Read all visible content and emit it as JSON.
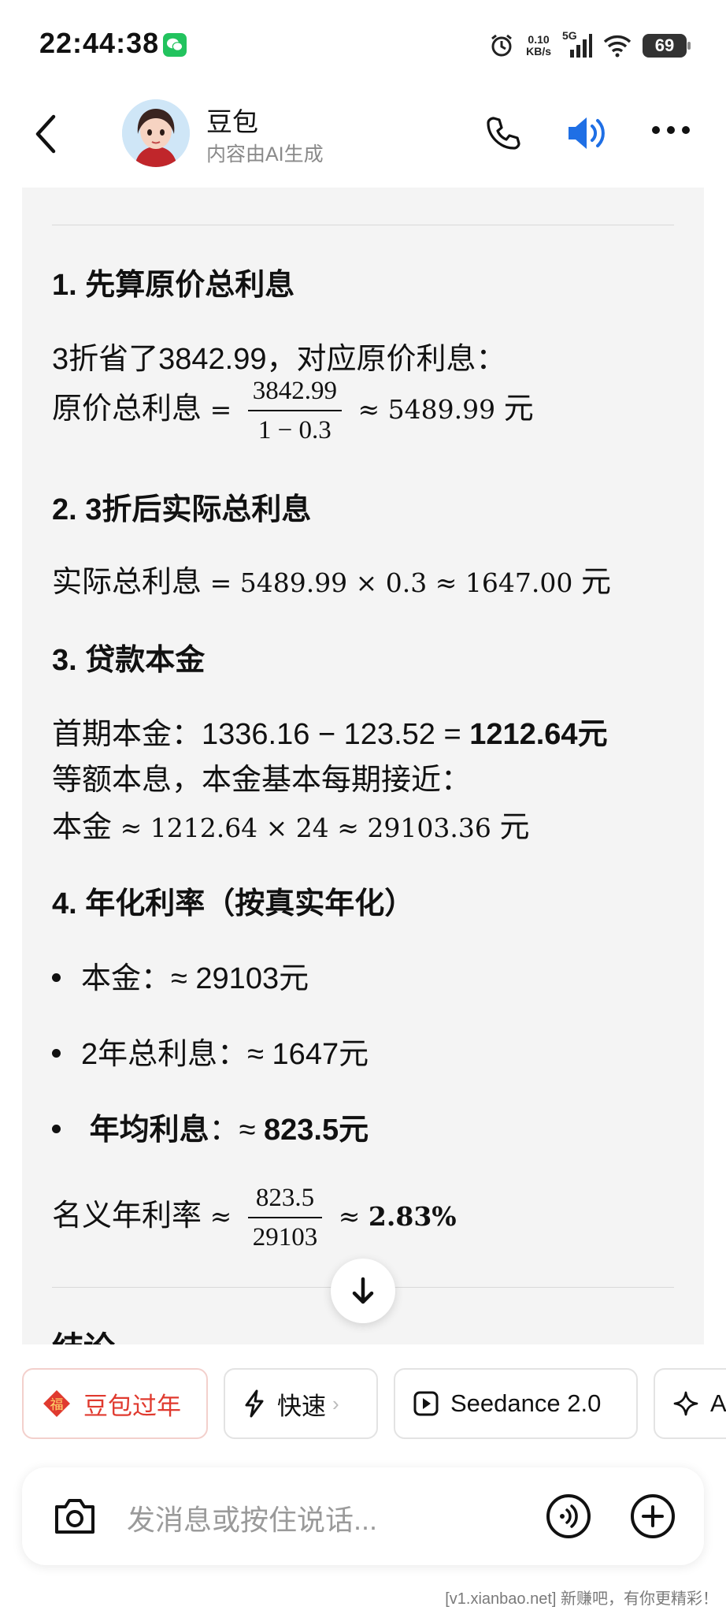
{
  "status_bar": {
    "time": "22:44:38",
    "net_speed_value": "0.10",
    "net_speed_unit": "KB/s",
    "network": "5G",
    "battery": "69"
  },
  "header": {
    "name": "豆包",
    "subtitle": "内容由AI生成"
  },
  "content": {
    "s1_title": "1. 先算原价总利息",
    "s1_line1": "3折省了3842.99，对应原价利息：",
    "s1_eq_label": "原价总利息",
    "s1_frac_num": "3842.99",
    "s1_frac_den": "1 − 0.3",
    "s1_eq_result": "≈ 5489.99",
    "s1_unit": "元",
    "s2_title": "2. 3折后实际总利息",
    "s2_eq_label": "实际总利息",
    "s2_eq_expr": "= 5489.99 × 0.3 ≈ 1647.00",
    "s2_unit": "元",
    "s3_title": "3. 贷款本金",
    "s3_line1_prefix": "首期本金：1336.16 − 123.52 = ",
    "s3_line1_bold": "1212.64元",
    "s3_line2": "等额本息，本金基本每期接近：",
    "s3_eq_label": "本金",
    "s3_eq_expr": "≈ 1212.64 × 24 ≈ 29103.36",
    "s3_unit": "元",
    "s4_title": "4. 年化利率（按真实年化）",
    "bullet1": "本金：≈ 29103元",
    "bullet2": "2年总利息：≈ 1647元",
    "bullet3_label": "年均利息",
    "bullet3_sep": "：≈ ",
    "bullet3_value": "823.5元",
    "rate_label": "名义年利率",
    "rate_frac_num": "823.5",
    "rate_frac_den": "29103",
    "rate_result": "2.83%",
    "next_heading_partial": "结论"
  },
  "chips": [
    {
      "label": "豆包过年",
      "icon": "fortune-icon"
    },
    {
      "label": "快速",
      "icon": "lightning-icon"
    },
    {
      "label": "Seedance 2.0",
      "icon": "play-icon"
    },
    {
      "label": "A",
      "icon": "sparkle-icon"
    }
  ],
  "input": {
    "placeholder": "发消息或按住说话..."
  },
  "watermark": "[v1.xianbao.net] 新赚吧，有你更精彩！",
  "colors": {
    "accent_blue": "#1f6fe5",
    "chip_red": "#e03a2f",
    "wechat_green": "#22c35e",
    "card_bg": "#f4f4f4"
  }
}
